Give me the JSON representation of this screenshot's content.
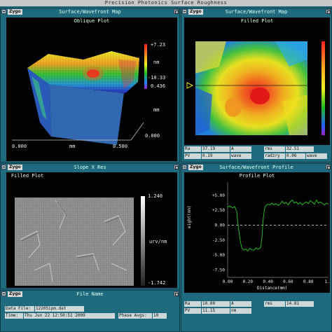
{
  "window_title": "Precision Photonics Surface Roughness",
  "logo": "Zygo",
  "oblique": {
    "header": "Surface/Wavefront Map",
    "plot_title": "Oblique Plot",
    "z_top": "+7.23",
    "z_unit": "nm",
    "z_bottom": "-10.33",
    "y_max": "0.436",
    "y_unit": "mm",
    "y_min": "0.000",
    "x_min": "0.000",
    "x_unit": "mm",
    "x_max": "0.580"
  },
  "filled_map": {
    "header": "Surface/Wavefront Map",
    "plot_title": "Filled Plot",
    "stats": {
      "ra_label": "Ra",
      "ra_value": "37.19",
      "ra_unit": "A",
      "rms_label": "rms",
      "rms_value": "32.51",
      "pv_label": "PV",
      "pv_value": "0.19",
      "pv_unit": "wave",
      "pv_value2": "0.06",
      "wave_unit": "wave",
      "extra_label": "radzry"
    }
  },
  "slope": {
    "header": "Slope X Res",
    "plot_title": "Filled Plot",
    "top_value": "1.240",
    "unit": "urv/nm",
    "bottom_value": "-1.742"
  },
  "profile": {
    "header": "Surface/Wavefront Profile",
    "plot_title": "Profile Plot",
    "ylabel": "eight(nm)",
    "xlabel": "Distance(mm)",
    "yticks": [
      "+5.00",
      "+2.50",
      "0.00",
      "-2.50",
      "-5.00",
      "-7.50"
    ],
    "xticks": [
      "0.00",
      "0.20",
      "0.40",
      "0.60",
      "0.80",
      "1.0"
    ],
    "stats": {
      "ra_label": "Ra",
      "ra_value": "10.00",
      "ra_unit": "A",
      "rms_label": "rms",
      "rms_value": "14.81",
      "pv_label": "PV",
      "pv_value": "11.15",
      "pv_unit": "nm"
    }
  },
  "file_panel": {
    "header": "File Name",
    "data_file_label": "Data File:",
    "data_file_value": "12205ipm.dat",
    "time_label": "Time:",
    "time_value": "Thu Jun 22 12:50:51 2009",
    "phase_label": "Phase Avgs:",
    "phase_value": "10"
  },
  "colors": {
    "panel_bg": "#1e6a7e",
    "plot_bg": "#000000",
    "profile_trace": "#22cc22"
  },
  "chart_data": {
    "type": "line",
    "xlabel": "Distance(mm)",
    "ylabel": "eight(nm)",
    "ylim": [
      -8.5,
      6.5
    ],
    "xlim": [
      0,
      1.0
    ],
    "series": [
      {
        "x": [
          0.0,
          0.02,
          0.05,
          0.07,
          0.09,
          0.1,
          0.11,
          0.12,
          0.13,
          0.14,
          0.16,
          0.18,
          0.2,
          0.22,
          0.24,
          0.26,
          0.28,
          0.3,
          0.32,
          0.33,
          0.34,
          0.35,
          0.36,
          0.37,
          0.38,
          0.4,
          0.42,
          0.44,
          0.46,
          0.48,
          0.5,
          0.52,
          0.54,
          0.56,
          0.58,
          0.6,
          0.62,
          0.64,
          0.66,
          0.68,
          0.7,
          0.72,
          0.74,
          0.76,
          0.78,
          0.8,
          0.82,
          0.84,
          0.86,
          0.88,
          0.9,
          0.92,
          0.94,
          0.96,
          0.98,
          1.0
        ],
        "y": [
          3.0,
          3.2,
          2.9,
          3.1,
          2.3,
          0.5,
          -0.8,
          -2.0,
          -3.0,
          -3.8,
          -4.2,
          -4.0,
          -4.3,
          -3.9,
          -4.1,
          -4.2,
          -3.8,
          -4.0,
          -3.9,
          -3.5,
          -2.0,
          0.5,
          2.0,
          3.0,
          3.3,
          3.5,
          3.4,
          3.7,
          3.4,
          3.6,
          3.3,
          3.5,
          4.0,
          3.6,
          3.8,
          3.4,
          3.9,
          4.2,
          3.7,
          3.9,
          3.5,
          3.8,
          3.4,
          3.7,
          3.9,
          3.6,
          4.1,
          3.8,
          3.5,
          4.2,
          3.7,
          3.9,
          3.6,
          3.4,
          3.7,
          3.5
        ]
      }
    ],
    "reference_line_y": 0.0,
    "grid": false
  }
}
